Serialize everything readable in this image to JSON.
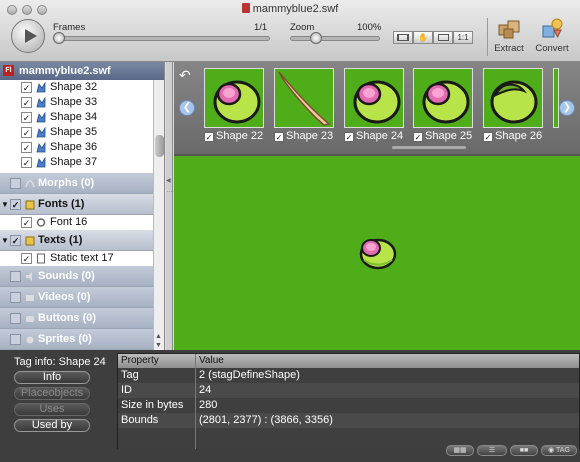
{
  "window": {
    "title": "mammyblue2.swf"
  },
  "toolbar": {
    "frames_label": "Frames",
    "frames_value": "1/1",
    "frames_progress": 0.0,
    "zoom_label": "Zoom",
    "zoom_value": "100%",
    "zoom_position": 0.25,
    "view_buttons": [
      "",
      "",
      "",
      "1:1"
    ],
    "extract_label": "Extract",
    "convert_label": "Convert"
  },
  "sidebar": {
    "file_name": "mammyblue2.swf",
    "shapes": [
      "Shape 32",
      "Shape 33",
      "Shape 34",
      "Shape 35",
      "Shape 36",
      "Shape 37"
    ],
    "categories": {
      "morphs": "Morphs (0)",
      "fonts": "Fonts (1)",
      "font_item": "Font 16",
      "texts": "Texts (1)",
      "text_item": "Static text 17",
      "sounds": "Sounds (0)",
      "videos": "Videos (0)",
      "buttons": "Buttons (0)",
      "sprites": "Sprites (0)"
    },
    "splitter_label": "........"
  },
  "shelf": {
    "thumbnails": [
      "Shape 22",
      "Shape 23",
      "Shape 24",
      "Shape 25",
      "Shape 26"
    ]
  },
  "taginfo": {
    "title": "Tag info: Shape 24",
    "buttons": [
      "Info",
      "Placeobjects",
      "Uses",
      "Used by"
    ]
  },
  "properties": {
    "header_property": "Property",
    "header_value": "Value",
    "rows": [
      {
        "property": "Tag",
        "value": "2 (stagDefineShape)"
      },
      {
        "property": "ID",
        "value": "24"
      },
      {
        "property": "Size in bytes",
        "value": "280"
      },
      {
        "property": "Bounds",
        "value": "(2801, 2377) : (3866, 3356)"
      }
    ]
  },
  "statusbar": {
    "buttons": [
      "",
      "",
      "",
      "TAG"
    ]
  },
  "colors": {
    "stage_green": "#4fad1a",
    "shape_outline": "#1a1a1a",
    "shape_pink": "#e36bb0",
    "shape_lime": "#b8e44a"
  }
}
